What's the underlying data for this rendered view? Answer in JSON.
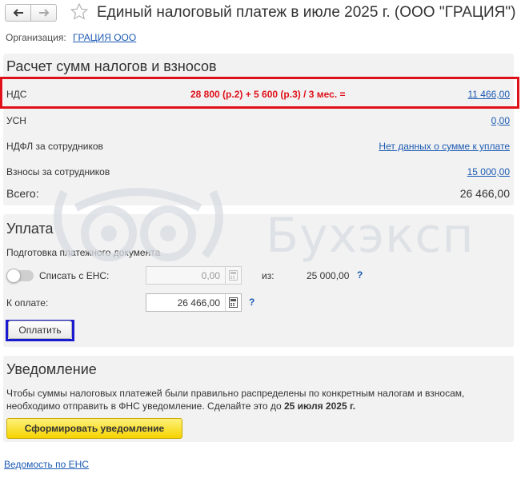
{
  "header": {
    "title": "Единый налоговый платеж в июле 2025 г. (ООО \"ГРАЦИЯ\")",
    "organization_label": "Организация:",
    "organization_value": "ГРАЦИЯ ООО"
  },
  "watermark": {
    "text": "Бухэксп"
  },
  "calc": {
    "title": "Расчет сумм налогов и взносов",
    "rows": [
      {
        "label": "НДС",
        "formula": "28 800 (р.2) + 5 600 (р.3) / 3 мес. =",
        "value": "11 466,00"
      },
      {
        "label": "УСН",
        "value": "0,00"
      },
      {
        "label": "НДФЛ за сотрудников",
        "value": "Нет данных о сумме к уплате"
      },
      {
        "label": "Взносы за сотрудников",
        "value": "15 000,00"
      }
    ],
    "total_label": "Всего:",
    "total_value": "26 466,00"
  },
  "payment": {
    "title": "Уплата",
    "subtitle": "Подготовка платежного документа",
    "ens_toggle_label": "Списать с ЕНС:",
    "ens_value": "0,00",
    "from_label": "из:",
    "from_value": "25 000,00",
    "help": "?",
    "to_pay_label": "К оплате:",
    "to_pay_value": "26 466,00",
    "pay_button": "Оплатить"
  },
  "notification": {
    "title": "Уведомление",
    "text_part1": "Чтобы суммы налоговых платежей были правильно распределены по конкретным налогам и взносам, необходимо отправить в ФНС уведомление. Сделайте это до ",
    "deadline": "25 июля 2025 г.",
    "button": "Сформировать уведомление"
  },
  "footer": {
    "link": "Ведомость по ЕНС"
  },
  "colors": {
    "accent_link": "#1c5ab3",
    "highlight_red": "#e0101a",
    "highlight_blue": "#1a1ad0",
    "panel_bg": "#f2f2f2",
    "primary_button": "#f5d300"
  }
}
